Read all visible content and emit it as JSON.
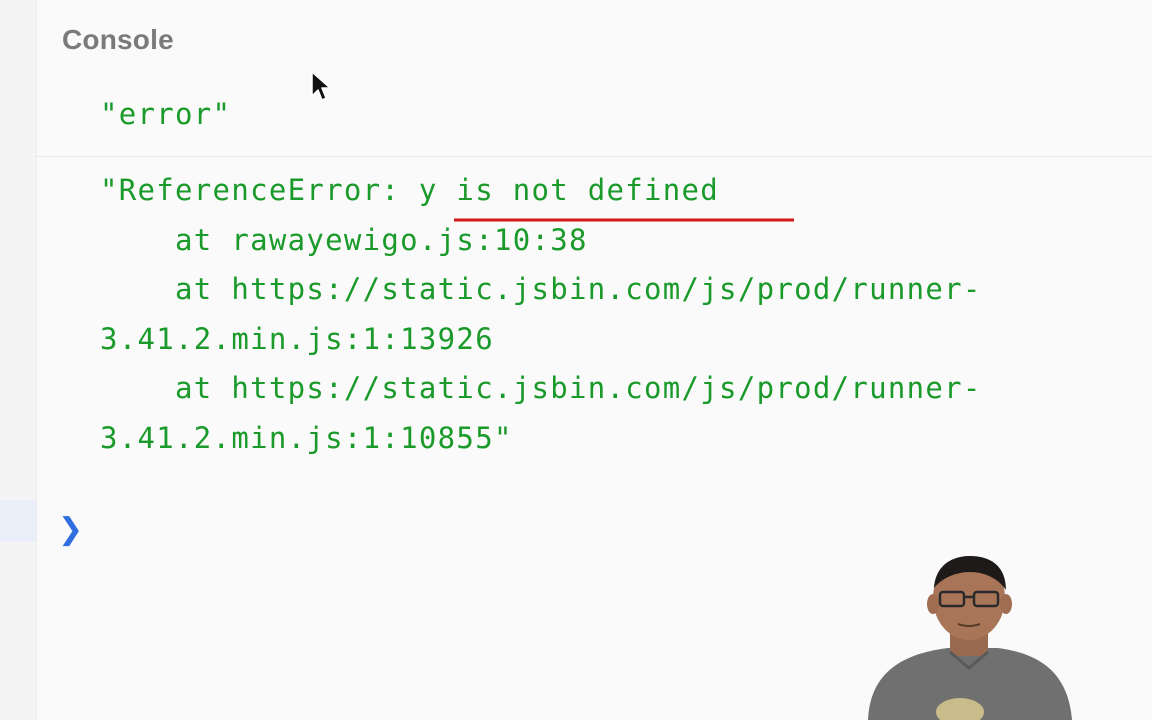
{
  "console": {
    "title": "Console",
    "logs": [
      {
        "text": "\"error\""
      },
      {
        "lines": [
          "\"ReferenceError: y is not defined",
          "    at rawayewigo.js:10:38",
          "    at https://static.jsbin.com/js/prod/runner-",
          "3.41.2.min.js:1:13926",
          "    at https://static.jsbin.com/js/prod/runner-",
          "3.41.2.min.js:1:10855\""
        ]
      }
    ],
    "prompt_icon": "chevron-right-icon"
  },
  "overlay": {
    "cursor_icon": "mouse-pointer-icon",
    "annotation_icon": "red-underline-annotation"
  },
  "colors": {
    "log_text": "#1a9a2a",
    "title_text": "#7a7a7a",
    "prompt": "#2f6fe0",
    "annotation": "#d01818",
    "background": "#fafafa"
  }
}
